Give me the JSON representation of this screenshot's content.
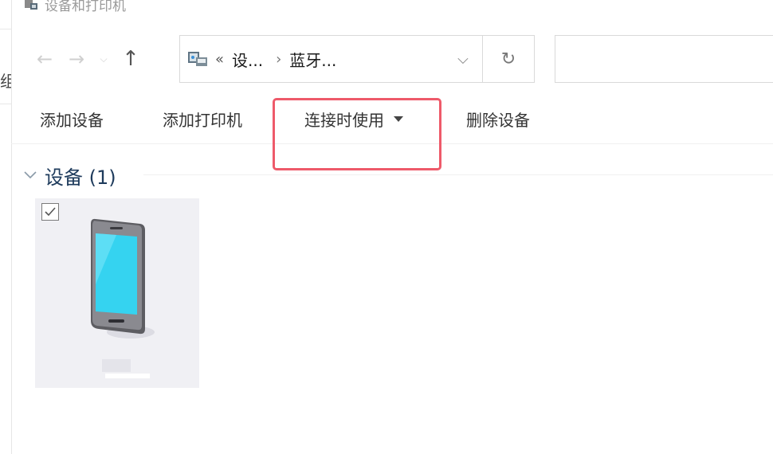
{
  "window": {
    "title": "设备和打印机"
  },
  "left_fragment": "组",
  "nav": {
    "back": "←",
    "forward": "→",
    "recent": "⌵",
    "up": "↑"
  },
  "address": {
    "overflow": "«",
    "crumbs": [
      "设...",
      "蓝牙..."
    ],
    "separator": "›",
    "dropdown": "⌵",
    "refresh": "↻"
  },
  "search": {
    "placeholder": ""
  },
  "commands": {
    "add_device": "添加设备",
    "add_printer": "添加打印机",
    "use_on_connect": "连接时使用",
    "remove_device": "删除设备"
  },
  "group": {
    "title": "设备 (1)"
  },
  "colors": {
    "highlight": "#ee5a6a",
    "group_title": "#1e3b5c",
    "tile_bg": "#f0f0f4",
    "screen": "#35d3f0",
    "phone_body": "#7b7b7f"
  }
}
